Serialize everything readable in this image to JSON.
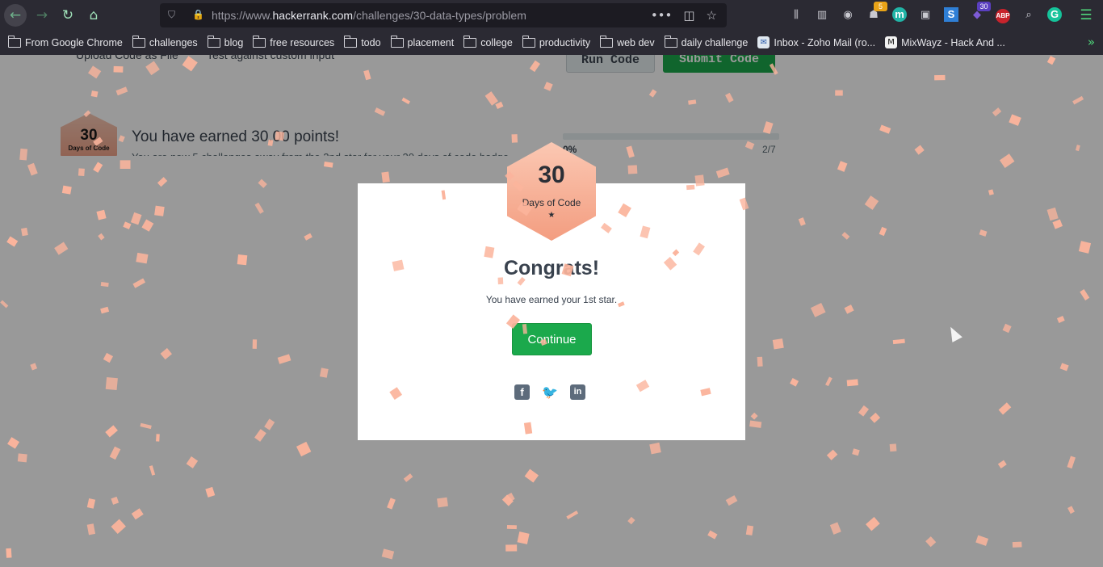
{
  "browser": {
    "url_prefix": "https://www.",
    "url_domain": "hackerrank.com",
    "url_path": "/challenges/30-data-types/problem",
    "ext_badge_1": "5",
    "ext_badge_2": "30",
    "ext_abp": "ABP",
    "ext_meet": "m"
  },
  "bookmarks": [
    {
      "label": "From Google Chrome",
      "type": "folder"
    },
    {
      "label": "challenges",
      "type": "folder"
    },
    {
      "label": "blog",
      "type": "folder"
    },
    {
      "label": "free resources",
      "type": "folder"
    },
    {
      "label": "todo",
      "type": "folder"
    },
    {
      "label": "placement",
      "type": "folder"
    },
    {
      "label": "college",
      "type": "folder"
    },
    {
      "label": "productivity",
      "type": "folder"
    },
    {
      "label": "web dev",
      "type": "folder"
    },
    {
      "label": "daily challenge",
      "type": "folder"
    },
    {
      "label": "Inbox - Zoho Mail (ro...",
      "type": "site"
    },
    {
      "label": "MixWayz - Hack And ...",
      "type": "site-dark"
    }
  ],
  "page": {
    "upload_label": "Upload Code as File",
    "custom_input_label": "Test against custom input",
    "run_label": "Run Code",
    "submit_label": "Submit Code",
    "mini_badge_number": "30",
    "mini_badge_text": "Days of Code",
    "earned_title": "You have earned 30.00 points!",
    "earned_sub": "You are now 5 challenges away from the 2nd star for your 30 days of code badge.",
    "progress_percent": "0%",
    "progress_count": "2/7"
  },
  "modal": {
    "badge_number": "30",
    "badge_label": "Days of Code",
    "badge_star": "★",
    "title": "Congrats!",
    "subtitle": "You have earned your 1st star.",
    "continue_label": "Continue",
    "share_facebook": "f",
    "share_twitter": "🐦",
    "share_linkedin": "in"
  },
  "colors": {
    "accent_green": "#1ba94c",
    "confetti": "#fbb49c",
    "badge_gradient_top": "#fbc8b3",
    "badge_gradient_bottom": "#f39d80"
  }
}
